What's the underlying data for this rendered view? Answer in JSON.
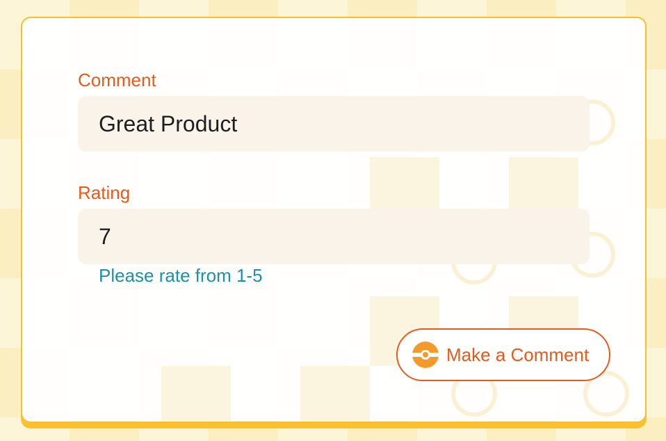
{
  "form": {
    "comment": {
      "label": "Comment",
      "value": "Great Product"
    },
    "rating": {
      "label": "Rating",
      "value": "7",
      "hint": "Please rate from 1-5"
    },
    "submit": {
      "label": "Make a Comment",
      "icon": "pokeball-icon"
    }
  },
  "colors": {
    "accent": "#e85a1b",
    "hint": "#1a91a8",
    "border": "#f7c02b",
    "input_bg": "#f9f3ea",
    "page_bg": "#fdf5d8"
  }
}
